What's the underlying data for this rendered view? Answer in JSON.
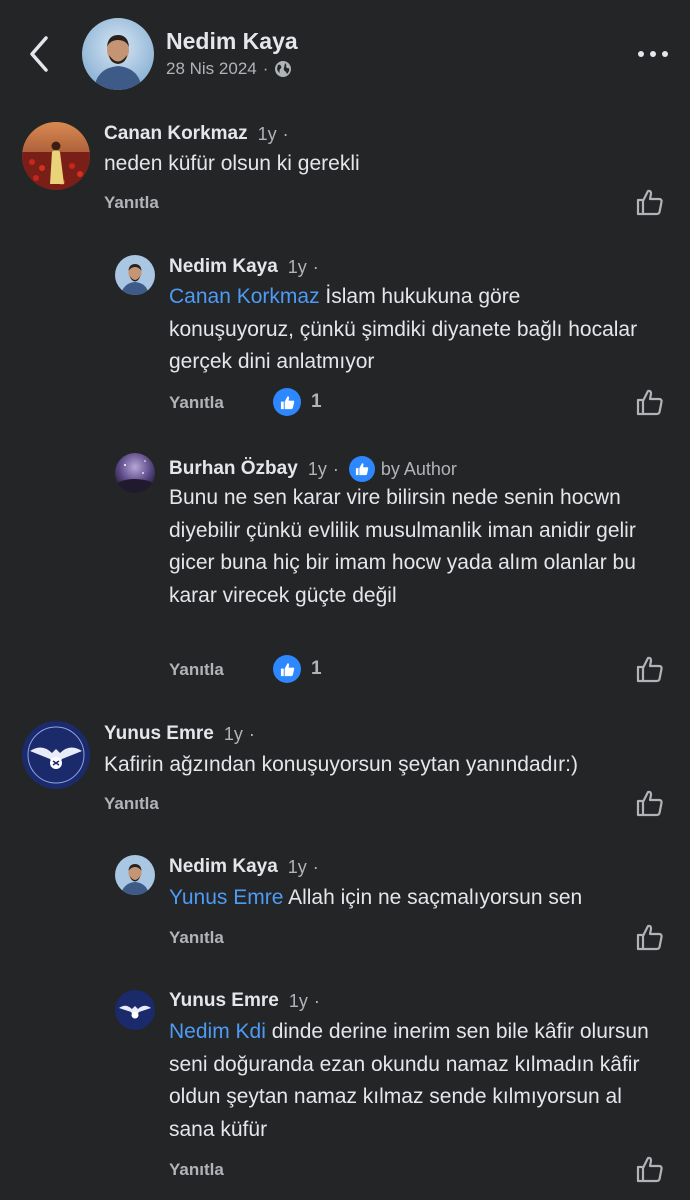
{
  "header": {
    "author_name": "Nedim Kaya",
    "date": "28 Nis 2024",
    "separator": "·",
    "privacy_icon": "globe-icon",
    "back_icon": "chevron-left-icon",
    "more_icon": "more-dots-icon"
  },
  "comments": [
    {
      "name": "Canan Korkmaz",
      "time": "1y",
      "dot": "·",
      "text": "neden küfür olsun ki gerekli",
      "reply_label": "Yanıtla"
    },
    {
      "name": "Nedim Kaya",
      "time": "1y",
      "dot": "·",
      "mention": "Canan Korkmaz",
      "text": " İslam hukukuna göre konuşuyoruz, çünkü şimdiki diyanete bağlı hocalar gerçek dini anlatmıyor",
      "reply_label": "Yanıtla",
      "reaction_count": "1"
    },
    {
      "name": "Burhan Özbay",
      "time": "1y",
      "dot": "·",
      "badge": "by Author",
      "text": "Bunu ne sen karar vire bilirsin nede senin hocwn diyebilir çünkü evlilik musulmanlik iman anidir gelir gicer buna  hiç bir imam hocw yada alım olanlar bu karar virecek güçte değil",
      "reply_label": "Yanıtla",
      "reaction_count": "1"
    },
    {
      "name": "Yunus Emre",
      "time": "1y",
      "dot": "·",
      "text": "Kafirin ağzından konuşuyorsun şeytan yanındadır:)",
      "reply_label": "Yanıtla"
    },
    {
      "name": "Nedim Kaya",
      "time": "1y",
      "dot": "·",
      "mention": "Yunus Emre",
      "text": " Allah için ne saçmalıyorsun sen",
      "reply_label": "Yanıtla"
    },
    {
      "name": "Yunus Emre",
      "time": "1y",
      "dot": "·",
      "mention": "Nedim Kdi",
      "text": " dinde derine inerim sen bile kâfir olursun seni doğuranda ezan okundu namaz kılmadın kâfir oldun şeytan namaz kılmaz sende kılmıyorsun al sana küfür",
      "reply_label": "Yanıtla"
    }
  ],
  "colors": {
    "background": "#242526",
    "text": "#e4e6eb",
    "secondary": "#b0b3b8",
    "mention": "#4d9bf6",
    "like_blue": "#2d88ff"
  }
}
